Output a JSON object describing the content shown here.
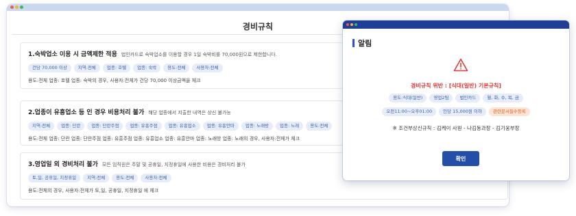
{
  "main": {
    "title": "경비규칙",
    "rules": [
      {
        "title": "1.숙박업소 이용 시 금액제한 적용",
        "desc": "법인카드로 숙박업소를 이용할 경우 1일 숙박비를 70,000원으로 제한합니다.",
        "chips": [
          "건당 70,000 이상",
          "지역:전체",
          "업종: 호텔",
          "업종: 숙박",
          "용도:전체",
          "사용자:전체"
        ],
        "check": "용도:전체 업종: 호텔 업종: 숙박의 경우, 사용자:전체가 건당 70,000 이상금액을 체크"
      },
      {
        "title": "2.업종이 유흥업소 등 인 경우 비용처리 불가",
        "desc": "해당 업종에서 지출한 내역은 상신 불가능",
        "chips": [
          "지역:전체",
          "업종: 단란",
          "업종: 단란주점",
          "업종: 유흥주점",
          "업종: 유흥업소",
          "업종: 유흥안마",
          "업종: 노래방",
          "업종: 노래",
          "용도:전체"
        ],
        "check": "용도:전체 업종: 단란 업종: 단란주점 업종: 유흥주점 업종: 유흥업소 업종: 유흥안마 업종: 노래방 업종: 노래의 경우, 사용자:전체가 체크"
      },
      {
        "title": "3.영업일 외 경비처리 불가",
        "desc": "모든 임직원은 주말 및 공휴일, 지정휴일에 사용한 비용은 경비처리 불가",
        "chips": [
          "토,일, 공휴일, 지정휴일",
          "지역:전체",
          "용도:전체",
          "사용자:전체"
        ],
        "check": "용도:전체의 경우, 사용자:전체가 토,일, 공휴일, 지정휴일 에 체크"
      }
    ]
  },
  "modal": {
    "title": "알림",
    "violation": "경비규칙 위반 : [식대(일반) 기본규칙]",
    "chips_row1": [
      "용도:식대(일반)",
      "영업2팀",
      "법인카드",
      "월, 화, 수, 목, 금"
    ],
    "chips_row2": [
      "오전11:00~오후01:00",
      "인당 15,000원 이하",
      "관련문서필수등록"
    ],
    "condition": "※ 조건부상신규칙 : 김케이 사원 - 나김동과장 - 김기웅부장",
    "confirm_label": "확인"
  },
  "icons": {
    "alert": "warning-triangle-icon"
  },
  "colors": {
    "accent": "#2a55c7",
    "modal_bar": "#1f3f96",
    "chip_bg": "#e6edf8",
    "chip_text": "#3d5ea8",
    "warning": "#e53935",
    "orange_chip_bg": "#fde3d4",
    "orange_chip_text": "#d9622a",
    "button": "#234fa8"
  }
}
